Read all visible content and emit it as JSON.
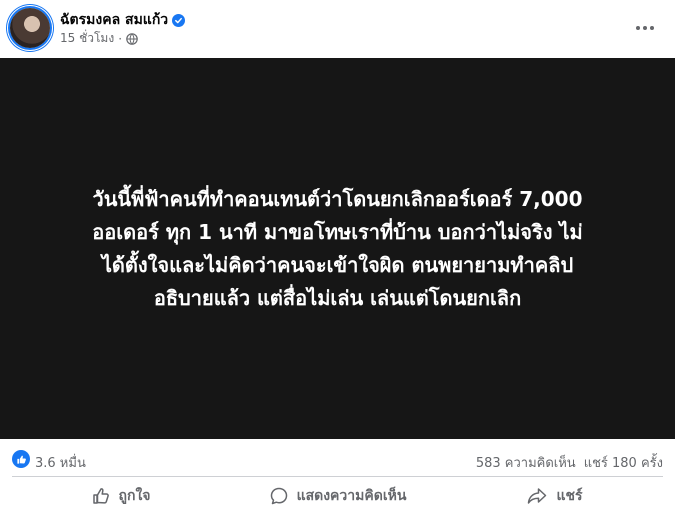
{
  "post": {
    "author": "ฉัตรมงคล สมแก้ว",
    "time": "15 ชั่วโมง",
    "separator": "·"
  },
  "media": {
    "text": "วันนี้พี่ฟ้าคนที่ทำคอนเทนต์ว่าโดนยกเลิกออร์เดอร์ 7,000\nออเดอร์ ทุก 1 นาที มาขอโทษเราที่บ้าน บอกว่าไม่จริง ไม่\nได้ตั้งใจและไม่คิดว่าคนจะเข้าใจผิด ตนพยายามทำคลิป\nอธิบายแล้ว แต่สื่อไม่เล่น เล่นแต่โดนยกเลิก"
  },
  "stats": {
    "reactions": "3.6 หมื่น",
    "comments": "583 ความคิดเห็น",
    "shares": "แชร์ 180 ครั้ง"
  },
  "actions": {
    "like": "ถูกใจ",
    "comment": "แสดงความคิดเห็น",
    "share": "แชร์"
  },
  "colors": {
    "accent": "#1877f2",
    "secondary_text": "#65676b",
    "media_bg": "#161616"
  },
  "icons": [
    "globe-icon",
    "verified-badge-icon",
    "more-options-icon",
    "like-reaction-icon",
    "like-icon",
    "comment-icon",
    "share-icon"
  ]
}
